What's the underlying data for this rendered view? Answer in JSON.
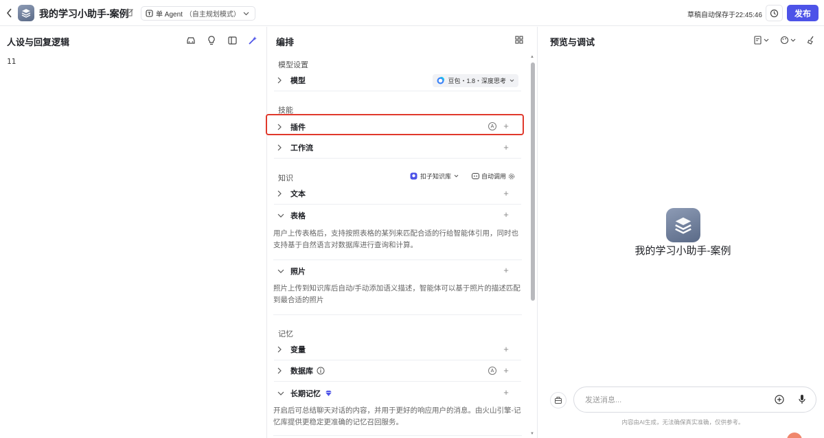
{
  "header": {
    "app_title": "我的学习小助手-案例",
    "agent_mode": "单 Agent",
    "agent_mode_sub": "（自主规划模式）",
    "save_status": "草稿自动保存于22:45:46",
    "publish_label": "发布"
  },
  "left": {
    "title": "人设与回复逻辑",
    "prompt": "11"
  },
  "middle": {
    "title": "编排",
    "model_section": "模型设置",
    "model_label": "模型",
    "model_value": "豆包・1.8・深度思考",
    "skills_section": "技能",
    "plugin_label": "插件",
    "workflow_label": "工作流",
    "knowledge_section": "知识",
    "kb_select": "扣子知识库",
    "auto_call": "自动调用",
    "text_label": "文本",
    "table_label": "表格",
    "table_desc": "用户上传表格后，支持按照表格的某列来匹配合适的行给智能体引用，同时也支持基于自然语言对数据库进行查询和计算。",
    "photo_label": "照片",
    "photo_desc": "照片上传到知识库后自动/手动添加语义描述，智能体可以基于照片的描述匹配到最合适的照片",
    "memory_section": "记忆",
    "variable_label": "变量",
    "database_label": "数据库",
    "longterm_label": "长期记忆",
    "longterm_desc": "开启后可总结聊天对话的内容，并用于更好的响应用户的消息。由火山引擎-记忆库提供更稳定更准确的记忆召回服务。",
    "auto_badge": "A"
  },
  "right": {
    "title": "预览与调试",
    "bot_name": "我的学习小助手-案例",
    "input_placeholder": "发送消息...",
    "disclaimer": "内容由AI生成，无法确保真实准确，仅供参考。"
  }
}
